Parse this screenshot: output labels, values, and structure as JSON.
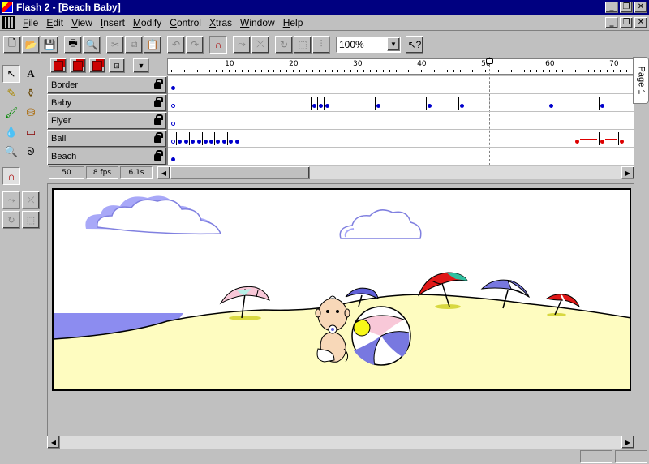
{
  "window": {
    "title": "Flash 2 - [Beach Baby]"
  },
  "menu": [
    "File",
    "Edit",
    "View",
    "Insert",
    "Modify",
    "Control",
    "Xtras",
    "Window",
    "Help"
  ],
  "toolbar": {
    "zoom_value": "100%",
    "icons": [
      "new-icon",
      "open-icon",
      "save-icon",
      "print-icon",
      "print-preview-icon",
      "cut-icon",
      "copy-icon",
      "paste-icon",
      "undo-icon",
      "redo-icon",
      "snap-icon",
      "smooth-icon",
      "straighten-icon",
      "rotate-icon",
      "scale-icon",
      "align-icon",
      "help-pointer-icon"
    ]
  },
  "tools": [
    "arrow-tool",
    "text-tool",
    "pencil-tool",
    "ink-bottle-tool",
    "brush-tool",
    "paint-bucket-tool",
    "dropper-tool",
    "eraser-tool",
    "zoom-tool",
    "lasso-tool"
  ],
  "timeline": {
    "ruler_labels": [
      "10",
      "20",
      "30",
      "40",
      "50",
      "60",
      "70"
    ],
    "current_frame": "50",
    "frame_rate": "8 fps",
    "elapsed": "6.1s",
    "layers": [
      {
        "name": "Border",
        "keyframes": [
          1
        ]
      },
      {
        "name": "Baby",
        "keyframes": [
          1,
          23,
          24,
          25,
          33,
          41,
          46,
          60,
          68
        ]
      },
      {
        "name": "Flyer",
        "keyframes": [
          1
        ]
      },
      {
        "name": "Ball",
        "keyframes": [
          1,
          2,
          3,
          4,
          5,
          6,
          7,
          8,
          9,
          10,
          11
        ],
        "tween_keyframes": [
          64,
          68,
          71
        ]
      },
      {
        "name": "Beach",
        "keyframes": [
          1
        ]
      }
    ]
  },
  "scene_tab": "Page 1",
  "colors": {
    "selection": "#000080",
    "keyframe": "#0000cc",
    "tween": "#dd0000",
    "sand": "#fefcc0",
    "sea": "#8c8cf0"
  }
}
